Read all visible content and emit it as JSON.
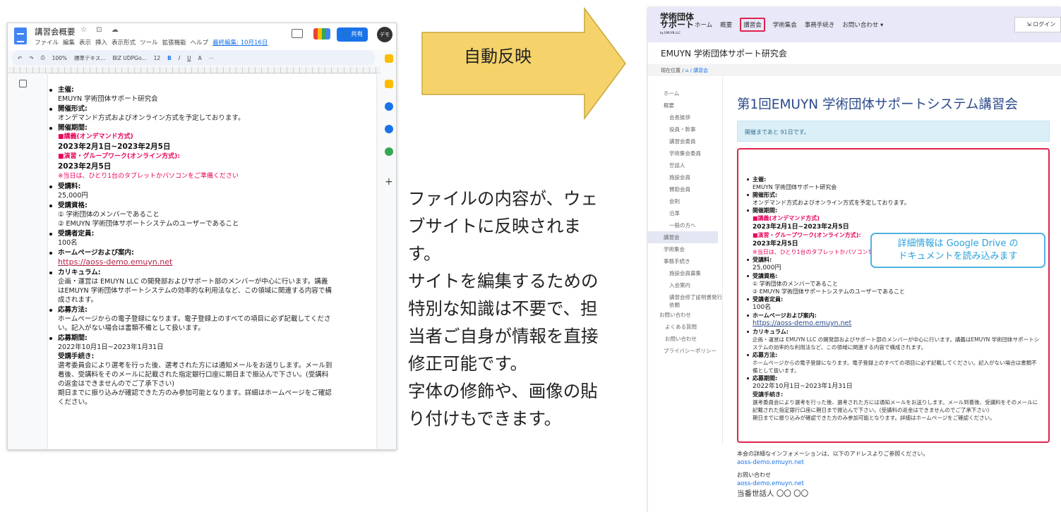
{
  "docs": {
    "title": "講習会概要",
    "menu": [
      "ファイル",
      "編集",
      "表示",
      "挿入",
      "表示形式",
      "ツール",
      "拡張機能",
      "ヘルプ"
    ],
    "last_edit": "最終編集: 10月16日",
    "share": "共有",
    "avatar": "デモ",
    "toolbar": {
      "zoom": "100%",
      "style": "標準テキス...",
      "font": "BIZ UDPGo...",
      "size": "12"
    }
  },
  "content": {
    "host_label": "主催:",
    "host": "EMUYN 学術団体サポート研究会",
    "format_label": "開催形式:",
    "format": "オンデマンド方式およびオンライン方式を予定しております。",
    "period_label": "開催期間:",
    "lecture_label": "■講義(オンデマンド方式)",
    "lecture_dates": "2023年2月1日~2023年2月5日",
    "workshop_label": "■演習・グループワーク(オンライン方式):",
    "workshop_date": "2023年2月5日",
    "device_note": "※当日は、ひとり1台のタブレットかパソコンをご準備ください",
    "fee_label": "受講料:",
    "fee": "25,000円",
    "qual_label": "受講資格:",
    "qual_1": "① 学術団体のメンバーであること",
    "qual_2": "② EMUYN 学術団体サポートシステムのユーザーであること",
    "capacity_label": "受講者定員:",
    "capacity": "100名",
    "hp_label": "ホームページおよび案内:",
    "hp_url": "https://aoss-demo.emuyn.net",
    "curriculum_label": "カリキュラム:",
    "curriculum": "企画・運営は EMUYN LLC の開発部およびサポート部のメンバーが中心に行います。講義はEMUYN 学術団体サポートシステムの効率的な利用法など、この領域に関連する内容で構成されます。",
    "apply_label": "応募方法:",
    "apply": "ホームページからの電子登録になります。電子登録上のすべての項目に必ず記載してください。記入がない場合は書類不備として扱います。",
    "apply_period_label": "応募期間:",
    "apply_period": "2022年10月1日~2023年1月31日",
    "procedure_label": "受講手続き:",
    "procedure_1": "選考委員会により選考を行った後、選考された方には通知メールをお送りします。メール到着後、受講料をそのメールに記載された指定銀行口座に期日まで振込んで下さい。(受講料の返金はできませんのでご了承下さい)",
    "procedure_2": "期日までに振り込みが確認できた方のみ参加可能となります。詳細はホームページをご確認ください。"
  },
  "arrow_label": "自動反映",
  "caption_lines": [
    "ファイルの内容が、ウェ",
    "ブサイトに反映されま",
    "す。",
    "サイトを編集するための",
    "特別な知識は不要で、担",
    "当者ご自身が情報を直接",
    "修正可能です。",
    "字体の修飾や、画像の貼",
    "り付けもできます。"
  ],
  "site": {
    "logo_1": "学術団体",
    "logo_2": "サポート",
    "logo_3": "by EMUYN LLC",
    "nav": [
      "ホーム",
      "概要",
      "講習会",
      "学術集会",
      "事務手続き",
      "お問い合わせ ▾"
    ],
    "login": "ログイン",
    "org_name": "EMUYN 学術団体サポート研究会",
    "crumb_prefix": "現在位置 /",
    "crumb_home": "⌂",
    "crumb_current": "/ 講習会",
    "sidebar": [
      {
        "label": "ホーム",
        "level": 1
      },
      {
        "label": "概要",
        "level": 1
      },
      {
        "label": "会長挨拶",
        "level": 2
      },
      {
        "label": "役員・幹事",
        "level": 2
      },
      {
        "label": "講習会委員",
        "level": 2
      },
      {
        "label": "学術集会委員",
        "level": 2
      },
      {
        "label": "世話人",
        "level": 2
      },
      {
        "label": "施設会員",
        "level": 2
      },
      {
        "label": "賛助会員",
        "level": 2
      },
      {
        "label": "会則",
        "level": 2
      },
      {
        "label": "沿革",
        "level": 2
      },
      {
        "label": "一般の方へ",
        "level": 2
      },
      {
        "label": "講習会",
        "level": 1,
        "active": true
      },
      {
        "label": "学術集会",
        "level": 1
      },
      {
        "label": "事務手続き",
        "level": 1
      },
      {
        "label": "施設会員募集",
        "level": 2
      },
      {
        "label": "入会案内",
        "level": 2
      },
      {
        "label": "講習会修了証明書発行",
        "level": 2
      },
      {
        "label": "依頼",
        "level": 2
      },
      {
        "label": "お問い合わせ",
        "level": 1
      },
      {
        "label": "よくある質問",
        "level": 2
      },
      {
        "label": "お問い合わせ",
        "level": 2
      },
      {
        "label": "プライバシーポリシー",
        "level": 1
      }
    ],
    "page_title": "第1回EMUYN 学術団体サポートシステム講習会",
    "alert": "開催まであと 91日です。",
    "callout_1": "詳細情報は Google Drive の",
    "callout_2": "ドキュメントを読み込みます",
    "footer_intro": "本会の詳細なインフォメーションは、以下のアドレスよりご参照ください。",
    "footer_link_1": "aoss-demo.emuyn.net",
    "footer_contact": "お問い合わせ",
    "footer_link_2": "aoss-demo.emuyn.net",
    "footer_person": "当番世話人  〇〇 〇〇"
  },
  "colors": {
    "accent_red": "#e0234e",
    "callout_blue": "#2aa1db",
    "arrow_fill": "#f5d36a",
    "docs_blue": "#1a73e8"
  }
}
